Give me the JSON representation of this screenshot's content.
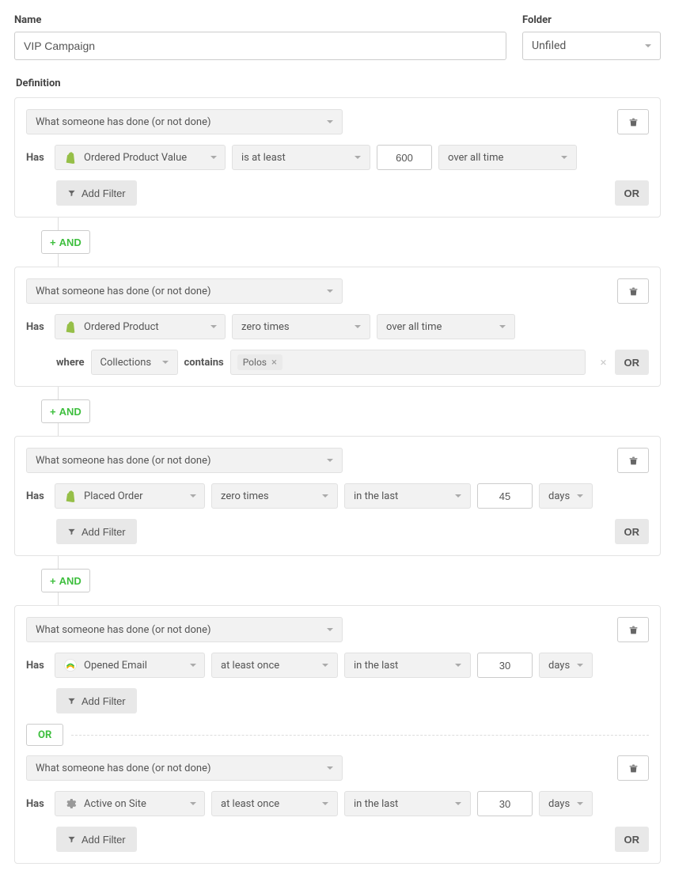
{
  "labels": {
    "name": "Name",
    "folder": "Folder",
    "definition": "Definition",
    "has": "Has",
    "where": "where",
    "contains": "contains",
    "days": "days",
    "add_filter": "Add Filter",
    "or": "OR",
    "and": "AND"
  },
  "name_value": "VIP Campaign",
  "folder_value": "Unfiled",
  "condition_type": "What someone has done (or not done)",
  "blocks": [
    {
      "event": "Ordered Product Value",
      "icon": "shopify",
      "op": "is at least",
      "value": "600",
      "time": "over all time"
    },
    {
      "event": "Ordered Product",
      "icon": "shopify",
      "op": "zero times",
      "time": "over all time",
      "where_field": "Collections",
      "where_op": "contains",
      "where_tag": "Polos"
    },
    {
      "event": "Placed Order",
      "icon": "shopify",
      "op": "zero times",
      "time": "in the last",
      "value": "45",
      "unit": "days"
    },
    {
      "event": "Opened Email",
      "icon": "klaviyo",
      "op": "at least once",
      "time": "in the last",
      "value": "30",
      "unit": "days"
    },
    {
      "event": "Active on Site",
      "icon": "gear",
      "op": "at least once",
      "time": "in the last",
      "value": "30",
      "unit": "days"
    }
  ]
}
